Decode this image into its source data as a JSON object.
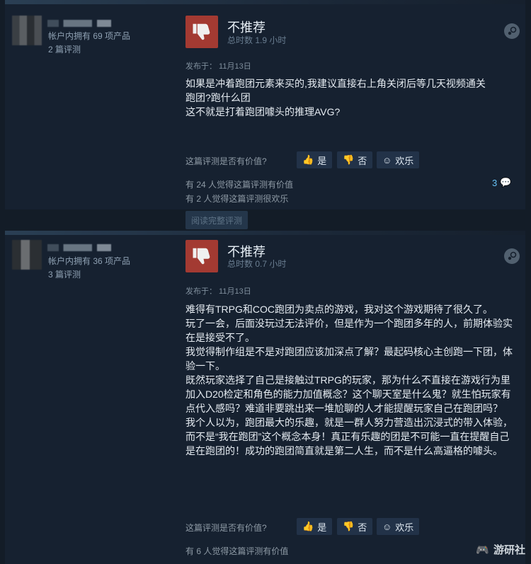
{
  "reviews": [
    {
      "products": "帐户内拥有 69 项产品",
      "review_count": "2 篇评测",
      "verdict": "不推荐",
      "hours": "总时数 1.9 小时",
      "posted": "发布于：   11月13日",
      "lines": [
        "如果是冲着跑团元素来买的,我建议直接右上角关闭后等几天视频通关",
        "跑团?跑什么团",
        "这不就是打着跑团噱头的推理AVG?"
      ],
      "helpful_q": "这篇评测是否有价值?",
      "yes": "是",
      "no": "否",
      "funny": "欢乐",
      "stat1": "有 24 人觉得这篇评测有价值",
      "stat2": "有 2 人觉得这篇评测很欢乐",
      "comments": "3",
      "readmore": "阅读完整评测"
    },
    {
      "products": "帐户内拥有 36 项产品",
      "review_count": "3 篇评测",
      "verdict": "不推荐",
      "hours": "总时数 0.7 小时",
      "posted": "发布于：   11月13日",
      "lines": [
        "难得有TRPG和COC跑团为卖点的游戏，我对这个游戏期待了很久了。",
        "玩了一会，后面没玩过无法评价，但是作为一个跑团多年的人，前期体验实在是接受不了。",
        "我觉得制作组是不是对跑团应该加深点了解？最起码核心主创跑一下团，体验一下。",
        "既然玩家选择了自己是接触过TRPG的玩家，那为什么不直接在游戏行为里加入D20检定和角色的能力加值概念？这个聊天室是什么鬼？就生怕玩家有点代入感吗？难道非要跳出来一堆尬聊的人才能提醒玩家自己在跑团吗？",
        "我个人以为，跑团最大的乐趣，就是一群人努力营造出沉浸式的带入体验，而不是“我在跑团”这个概念本身！真正有乐趣的团是不可能一直在提醒自己是在跑团的！成功的跑团简直就是第二人生，而不是什么高逼格的噱头。"
      ],
      "helpful_q": "这篇评测是否有价值?",
      "yes": "是",
      "no": "否",
      "funny": "欢乐",
      "stat1": "有 6 人觉得这篇评测有价值"
    }
  ],
  "watermark": "游研社"
}
